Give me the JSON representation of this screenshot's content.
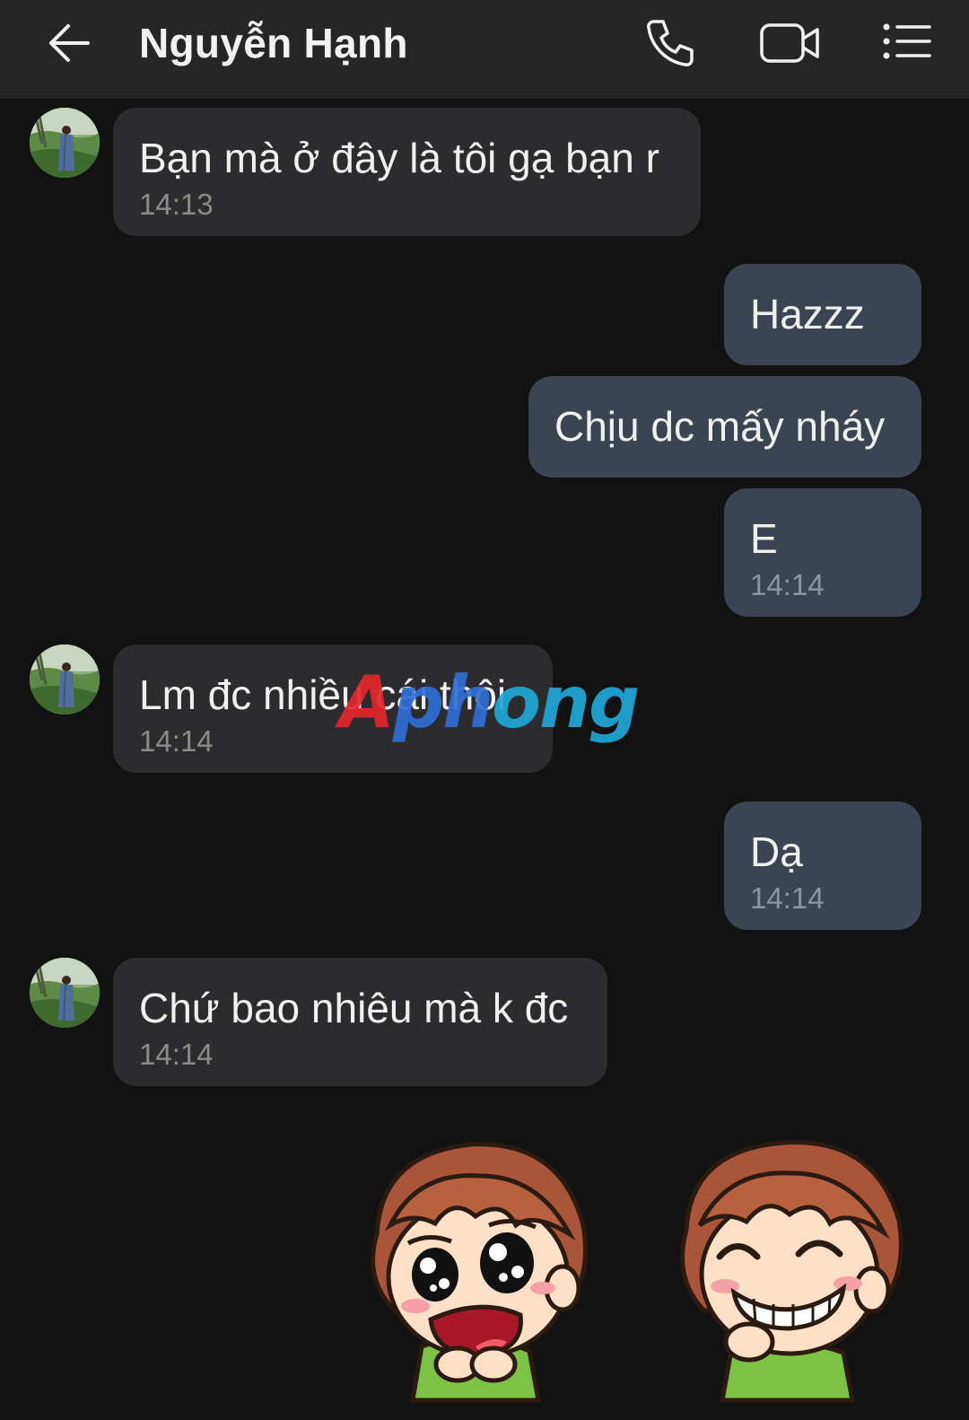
{
  "header": {
    "title": "Nguyễn Hạnh",
    "back_icon": "arrow-left-icon",
    "call_icon": "phone-icon",
    "video_icon": "video-camera-icon",
    "menu_icon": "list-menu-icon"
  },
  "messages": [
    {
      "direction": "in",
      "text": "Bạn mà ở đây là tôi gạ bạn r",
      "time": "14:13"
    },
    {
      "direction": "out",
      "text": "Hazzz",
      "time": ""
    },
    {
      "direction": "out",
      "text": "Chịu dc mấy nháy",
      "time": ""
    },
    {
      "direction": "out",
      "text": "E",
      "time": "14:14"
    },
    {
      "direction": "in",
      "text": "Lm đc nhiều cái thôi",
      "time": "14:14"
    },
    {
      "direction": "out",
      "text": "Dạ",
      "time": "14:14"
    },
    {
      "direction": "in",
      "text": "Chứ bao nhiêu mà k đc",
      "time": "14:14"
    }
  ],
  "watermark": {
    "part1": "A",
    "part2": "ph",
    "part3": "ong"
  },
  "stickers": [
    {
      "name": "crying-boy-sticker",
      "emotion": "crying"
    },
    {
      "name": "grinning-boy-sticker",
      "emotion": "grinning"
    }
  ],
  "colors": {
    "background": "#121212",
    "header": "#262626",
    "incoming_bubble": "#2c2c2e",
    "outgoing_bubble": "#3a4452"
  }
}
